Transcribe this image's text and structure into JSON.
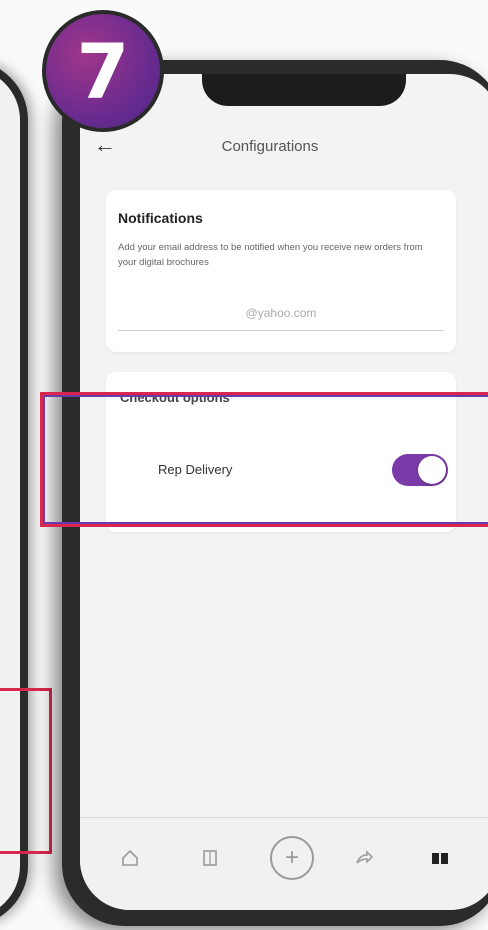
{
  "step": {
    "number": "7"
  },
  "header": {
    "title": "Configurations",
    "back_icon": "arrow-left-icon"
  },
  "notifications": {
    "title": "Notifications",
    "description": "Add your email address to be notified when you receive new orders from your digital brochures",
    "email_placeholder": "@yahoo.com"
  },
  "checkout": {
    "title": "Checkout options",
    "rep_delivery_label": "Rep Delivery",
    "rep_delivery_enabled": true
  },
  "bottom_nav": {
    "icons": [
      "home-icon",
      "catalog-icon",
      "add-icon",
      "share-icon",
      "book-icon"
    ]
  },
  "colors": {
    "accent": "#7a3aa8",
    "highlight": "#d8264f",
    "badge": "#6a2b8f"
  }
}
